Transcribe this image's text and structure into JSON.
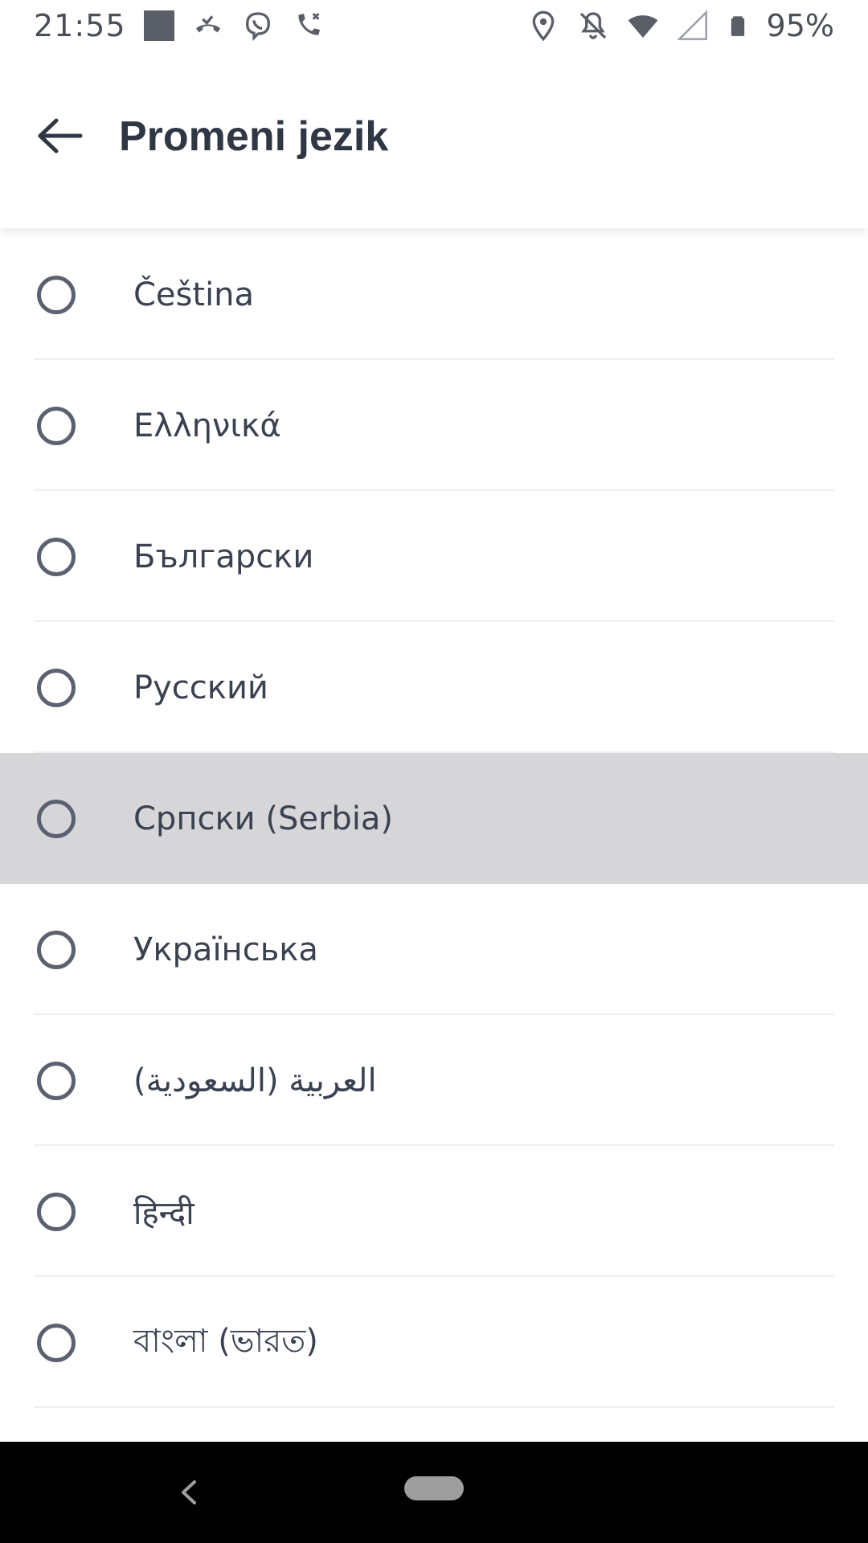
{
  "status_bar": {
    "time": "21:55",
    "battery": "95%",
    "icons_left": [
      "gallery-square-icon",
      "missed-call-icon",
      "viber-icon",
      "call-declined-icon"
    ],
    "icons_right": [
      "location-icon",
      "notifications-off-icon",
      "wifi-icon",
      "cell-signal-icon",
      "battery-icon"
    ]
  },
  "app_bar": {
    "title": "Promeni jezik",
    "back_icon": "arrow-left-icon"
  },
  "languages": [
    {
      "label": "Čeština",
      "selected": false,
      "highlighted": false
    },
    {
      "label": "Ελληνικά",
      "selected": false,
      "highlighted": false
    },
    {
      "label": "Български",
      "selected": false,
      "highlighted": false
    },
    {
      "label": "Русский",
      "selected": false,
      "highlighted": false
    },
    {
      "label": "Српски (Serbia)",
      "selected": false,
      "highlighted": true
    },
    {
      "label": "Українська",
      "selected": false,
      "highlighted": false
    },
    {
      "label": "العربية (السعودية)",
      "selected": false,
      "highlighted": false
    },
    {
      "label": "हिन्दी",
      "selected": false,
      "highlighted": false
    },
    {
      "label": "বাংলা (ভারত)",
      "selected": false,
      "highlighted": false
    }
  ],
  "nav_bar": {
    "back_icon": "nav-back-icon",
    "home_icon": "nav-home-pill-icon"
  },
  "colors": {
    "text": "#3a4150",
    "title": "#2f3644",
    "highlight": "#d6d6d8",
    "divider": "#eeeff1",
    "nav_bg": "#000000"
  }
}
